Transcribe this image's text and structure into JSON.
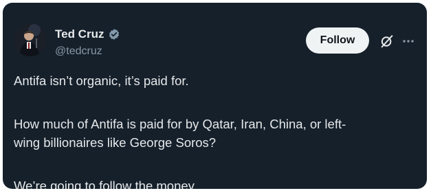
{
  "author": {
    "display_name": "Ted Cruz",
    "handle": "@tedcruz"
  },
  "actions": {
    "follow_label": "Follow"
  },
  "icons": {
    "verified": "verified-badge-icon",
    "grok": "grok-icon",
    "more": "more-options-icon"
  },
  "tweet": {
    "paragraphs": [
      "Antifa isn’t organic, it’s paid for.",
      "How much of Antifa is paid for by Qatar, Iran, China, or left-",
      "wing billionaires like George Soros?",
      "We’re going to follow the money."
    ]
  },
  "colors": {
    "background": "#15202b",
    "text_primary": "#e7e9ea",
    "text_secondary": "#8b98a5",
    "button_bg": "#eff3f4",
    "badge": "#829aab"
  }
}
